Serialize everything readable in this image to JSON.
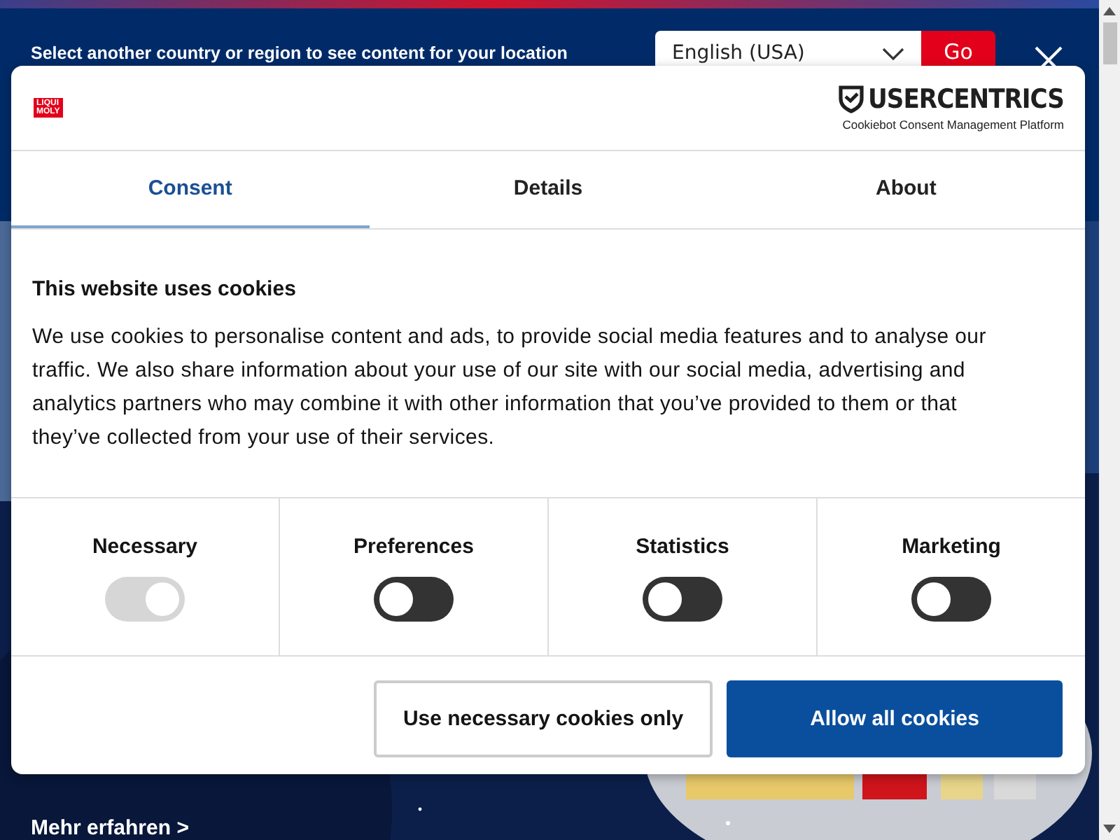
{
  "banner": {
    "message": "Select another country or region to see content for your location",
    "language": "English (USA)",
    "go_button": "Go"
  },
  "hero": {
    "link": "Mehr erfahren >"
  },
  "dialog": {
    "logo": [
      "LIQUI",
      "MOLY"
    ],
    "brand": {
      "name": "USERCENTRICS",
      "subtitle": "Cookiebot Consent Management Platform"
    },
    "tabs": [
      {
        "label": "Consent",
        "selected": true
      },
      {
        "label": "Details",
        "selected": false
      },
      {
        "label": "About",
        "selected": false
      }
    ],
    "title": "This website uses cookies",
    "body": "We use cookies to personalise content and ads, to provide social media features and to analyse our traffic. We also share information about your use of our site with our social media, advertising and analytics partners who may combine it with other information that you’ve provided to them or that they’ve collected from your use of their services.",
    "categories": [
      {
        "label": "Necessary",
        "on": true,
        "disabled": true
      },
      {
        "label": "Preferences",
        "on": false,
        "disabled": false
      },
      {
        "label": "Statistics",
        "on": false,
        "disabled": false
      },
      {
        "label": "Marketing",
        "on": false,
        "disabled": false
      }
    ],
    "buttons": [
      {
        "label": "Use necessary cookies only",
        "kind": "secondary"
      },
      {
        "label": "Allow all cookies",
        "kind": "primary"
      }
    ]
  }
}
